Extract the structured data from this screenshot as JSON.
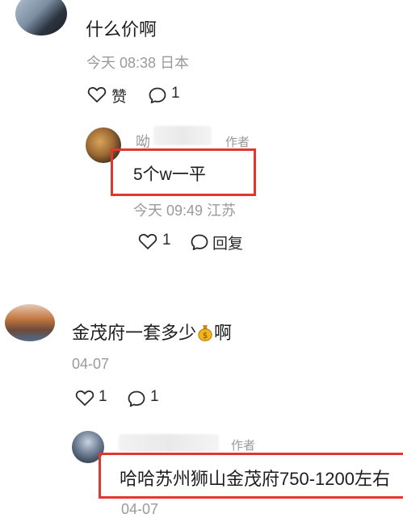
{
  "comments": [
    {
      "text": "什么价啊",
      "timestamp": "今天 08:38",
      "location": "日本",
      "like_label": "赞",
      "reply_count": "1"
    },
    {
      "username": "呦",
      "author_badge": "作者",
      "text": "5个w一平",
      "timestamp": "今天 09:49",
      "location": "江苏",
      "like_count": "1",
      "reply_label": "回复"
    },
    {
      "text_before_emoji": "金茂府一套多少",
      "emoji": "money-bag",
      "text_after_emoji": "啊",
      "date": "04-07",
      "like_count": "1",
      "reply_count": "1"
    },
    {
      "author_badge": "作者",
      "text": "哈哈苏州狮山金茂府750-1200左右",
      "date": "04-07"
    }
  ],
  "colors": {
    "highlight": "#e0382f",
    "meta_text": "#9a9a9a",
    "main_text": "#1d1d1d"
  }
}
